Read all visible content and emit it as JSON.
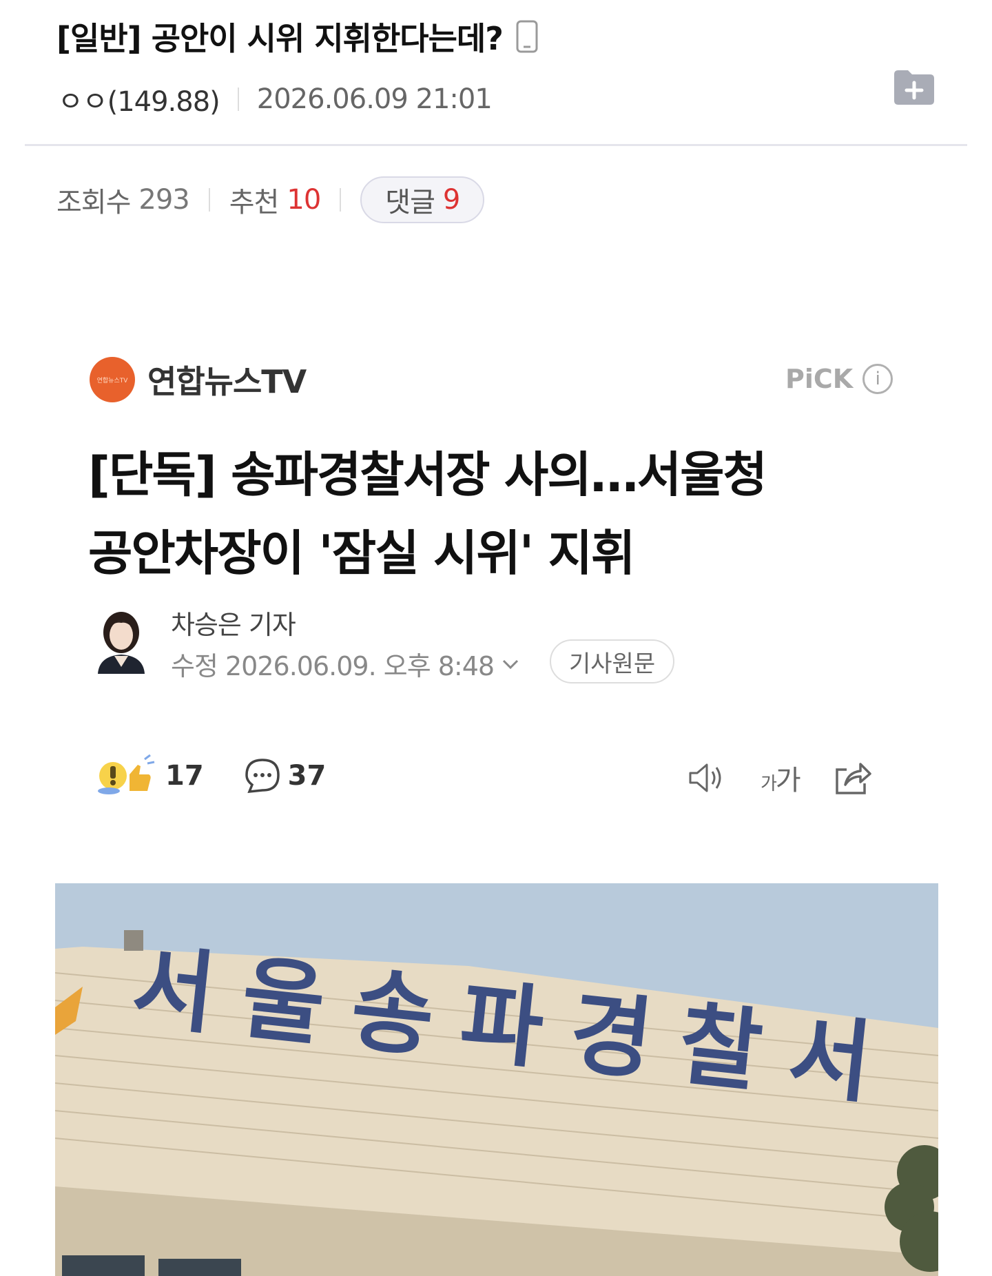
{
  "post": {
    "title": "[일반] 공안이 시위 지휘한다는데?",
    "author": "ㅇㅇ(149.88)",
    "datetime": "2026.06.09 21:01",
    "views_label": "조회수",
    "views": "293",
    "recommend_label": "추천",
    "recommend": "10",
    "comments_label": "댓글",
    "comments": "9"
  },
  "article": {
    "press_logo_text": "연합뉴스TV",
    "press_name": "연합뉴스TV",
    "pick_label": "PiCK",
    "headline_line1": "[단독] 송파경찰서장 사의…서울청",
    "headline_line2": "공안차장이 '잠실 시위' 지휘",
    "reporter": "차승은 기자",
    "edited": "수정 2026.06.09. 오후 8:48",
    "original_button": "기사원문",
    "reaction_count": "17",
    "comment_count": "37",
    "font_tool_small": "가",
    "font_tool_large": "가",
    "photo_sign_text": "서울송파경찰서"
  },
  "colors": {
    "accent_red": "#dd3333",
    "press_orange": "#e8612c",
    "sky": "#b5c8da",
    "sign_blue": "#3c4e82"
  },
  "icons": [
    "phone-icon",
    "folder-add-icon",
    "info-icon",
    "chevron-down-icon",
    "reaction-icon",
    "comment-icon",
    "speaker-icon",
    "share-icon"
  ]
}
